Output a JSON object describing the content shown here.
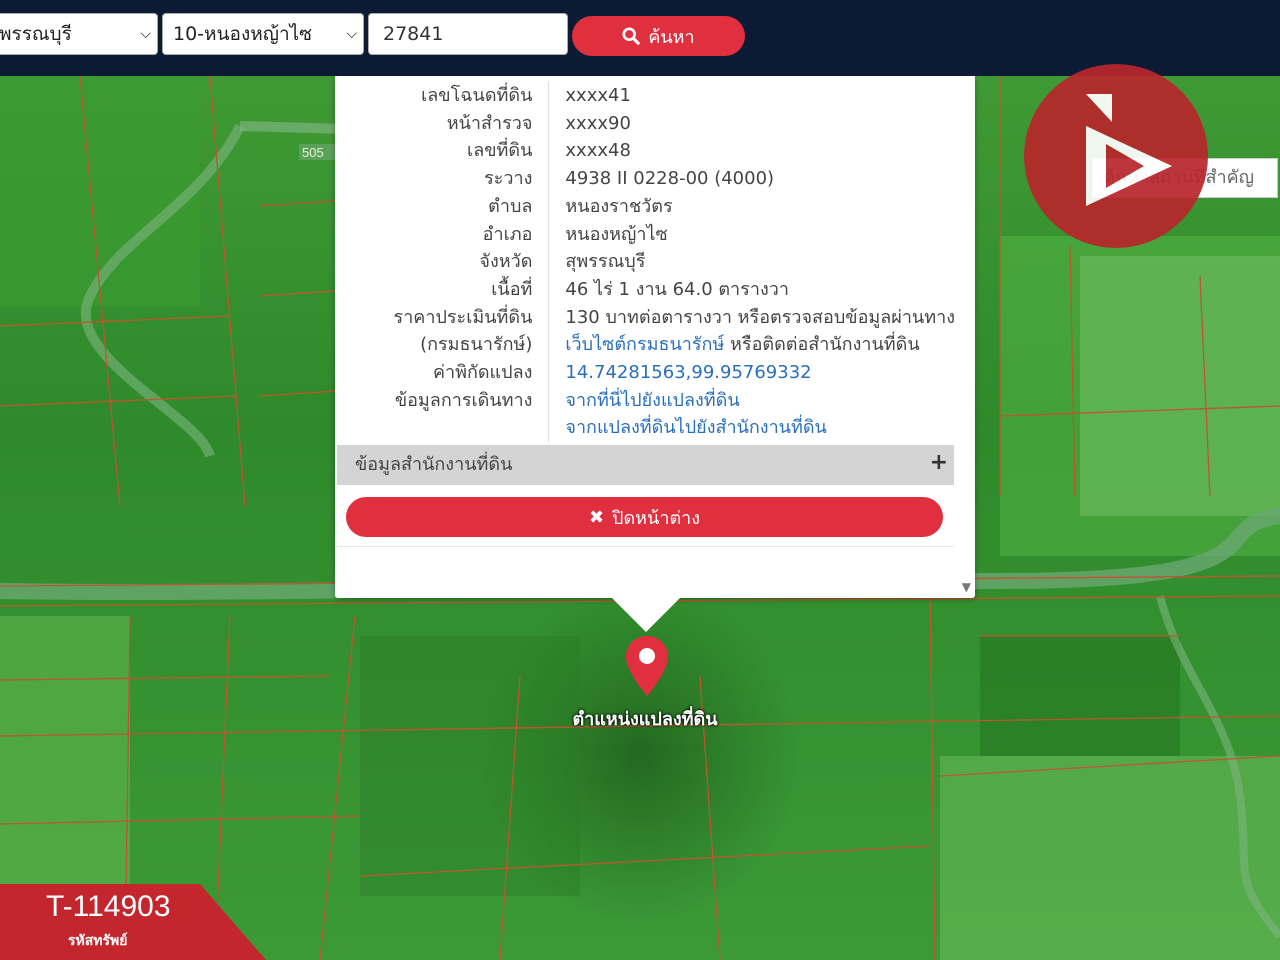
{
  "search": {
    "province": "พรรณบุรี",
    "district": "10-หนองหญ้าไซ",
    "deed_number": "27841",
    "button_label": "ค้นหา"
  },
  "map": {
    "place_search_placeholder": "ค้นหาสถานที่สำคัญ",
    "road_number": "505",
    "marker_label": "ตำแหน่งแปลงที่ดิน"
  },
  "popup": {
    "rows": [
      {
        "label": "เลขโฉนดที่ดิน",
        "value": "xxxx41"
      },
      {
        "label": "หน้าสำรวจ",
        "value": "xxxx90"
      },
      {
        "label": "เลขที่ดิน",
        "value": "xxxx48"
      },
      {
        "label": "ระวาง",
        "value": "4938 II 0228-00 (4000)"
      },
      {
        "label": "ตำบล",
        "value": "หนองราชวัตร"
      },
      {
        "label": "อำเภอ",
        "value": "หนองหญ้าไซ"
      },
      {
        "label": "จังหวัด",
        "value": "สุพรรณบุรี"
      },
      {
        "label": "เนื้อที่",
        "value": "46 ไร่ 1 งาน 64.0 ตารางวา"
      }
    ],
    "price_label": "ราคาประเมินที่ดิน",
    "price_label2": "(กรมธนารักษ์)",
    "price_text": "130 บาทต่อตารางวา หรือตรวจสอบข้อมูลผ่านทาง",
    "price_link": "เว็บไซต์กรมธนารักษ์",
    "price_text2": "หรือติดต่อสำนักงานที่ดิน",
    "coord_label": "ค่าพิกัดแปลง",
    "coord_value": "14.74281563,99.95769332",
    "travel_label": "ข้อมูลการเดินทาง",
    "travel_link1": "จากที่นี่ไปยังแปลงที่ดิน",
    "travel_link2": "จากแปลงที่ดินไปยังสำนักงานที่ดิน",
    "office_section": "ข้อมูลสำนักงานที่ดิน",
    "close_label": "ปิดหน้าต่าง"
  },
  "property": {
    "code": "T-114903",
    "code_label": "รหัสทรัพย์"
  },
  "colors": {
    "accent": "#e0303f",
    "header": "#0c1b33",
    "link": "#2a6fbd",
    "brand": "#b8262c"
  }
}
